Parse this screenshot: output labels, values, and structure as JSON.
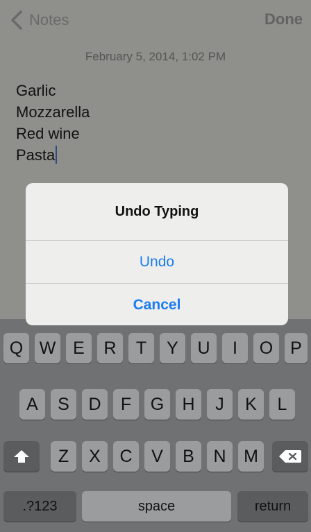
{
  "nav": {
    "back_label": "Notes",
    "done_label": "Done"
  },
  "note": {
    "date": "February 5, 2014, 1:02 PM",
    "lines": [
      "Garlic",
      "Mozzarella",
      "Red wine",
      "Pasta"
    ]
  },
  "alert": {
    "title": "Undo Typing",
    "undo_label": "Undo",
    "cancel_label": "Cancel"
  },
  "keyboard": {
    "row1": [
      "Q",
      "W",
      "E",
      "R",
      "T",
      "Y",
      "U",
      "I",
      "O",
      "P"
    ],
    "row2": [
      "A",
      "S",
      "D",
      "F",
      "G",
      "H",
      "J",
      "K",
      "L"
    ],
    "row3": [
      "Z",
      "X",
      "C",
      "V",
      "B",
      "N",
      "M"
    ],
    "numbers_label": ".?123",
    "space_label": "space",
    "return_label": "return"
  },
  "colors": {
    "accent": "#1b7cf0"
  }
}
